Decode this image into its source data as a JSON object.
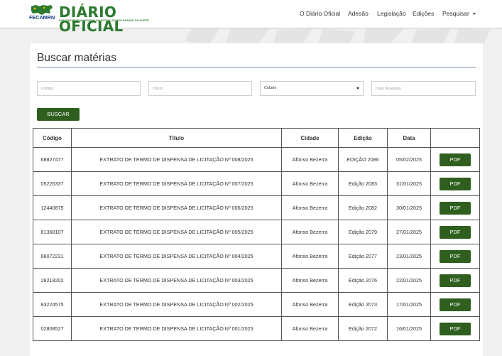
{
  "header": {
    "logo_abbr": "FECAMRN",
    "logo_title": "DIÁRIO OFICIAL",
    "logo_subtitle": "DAS CÂMARAS MUNICIPAIS DO ESTADO DO RIO GRANDE DO NORTE",
    "nav": [
      {
        "label": "O Diário Oficial"
      },
      {
        "label": "Adesão"
      },
      {
        "label": "Legislação"
      },
      {
        "label": "Edições"
      },
      {
        "label": "Pesquisar"
      }
    ]
  },
  "search": {
    "title": "Buscar matérias",
    "codigo_placeholder": "Código",
    "titulo_placeholder": "Título",
    "cidade_selected": "Cidade",
    "data_placeholder": "Data desejada",
    "button_label": "BUSCAR"
  },
  "table": {
    "headers": [
      "Código",
      "Título",
      "Cidade",
      "Edição",
      "Data",
      ""
    ],
    "rows": [
      {
        "codigo": "68827477",
        "titulo": "EXTRATO DE TERMO DE DISPENSA DE LICITAÇÃO Nº 008/2025",
        "cidade": "Afonso Bezerra",
        "edicao": "EDIÇÃO 2086",
        "data": "05/02/2025",
        "action": "PDF"
      },
      {
        "codigo": "05226337",
        "titulo": "EXTRATO DE TERMO DE DISPENSA DE LICITAÇÃO Nº 007/2025",
        "cidade": "Afonso Bezerra",
        "edicao": "Edição 2083",
        "data": "31/01/2025",
        "action": "PDF"
      },
      {
        "codigo": "12440875",
        "titulo": "EXTRATO DE TERMO DE DISPENSA DE LICITAÇÃO Nº 006/2025",
        "cidade": "Afonso Bezerra",
        "edicao": "Edição 2082",
        "data": "30/01/2025",
        "action": "PDF"
      },
      {
        "codigo": "81368107",
        "titulo": "EXTRATO DE TERMO DE DISPENSA DE LICITAÇÃO Nº 005/2025",
        "cidade": "Afonso Bezerra",
        "edicao": "Edição 2079",
        "data": "27/01/2025",
        "action": "PDF"
      },
      {
        "codigo": "66072231",
        "titulo": "EXTRATO DE TERMO DE DISPENSA DE LICITAÇÃO Nº 004/2025",
        "cidade": "Afonso Bezerra",
        "edicao": "Edição 2077",
        "data": "23/01/2025",
        "action": "PDF"
      },
      {
        "codigo": "28218202",
        "titulo": "EXTRATO DE TERMO DE DISPENSA DE LICITAÇÃO Nº 003/2025",
        "cidade": "Afonso Bezerra",
        "edicao": "Edição 2076",
        "data": "22/01/2025",
        "action": "PDF"
      },
      {
        "codigo": "83224575",
        "titulo": "EXTRATO DE TERMO DE DISPENSA DE LICITAÇÃO Nº 002/2025",
        "cidade": "Afonso Bezerra",
        "edicao": "Edição 2073",
        "data": "17/01/2025",
        "action": "PDF"
      },
      {
        "codigo": "02808527",
        "titulo": "EXTRATO DE TERMO DE DISPENSA DE LICITAÇÃO Nº 001/2025",
        "cidade": "Afonso Bezerra",
        "edicao": "Edição 2072",
        "data": "16/01/2025",
        "action": "PDF"
      }
    ]
  },
  "colors": {
    "brand_green": "#2b7a2e",
    "button_green": "#2e5f1e",
    "logo_blue": "#1c3f8a"
  },
  "icons": {
    "dropdown": "chevron-down-icon",
    "logo": "rn-state-map-icon"
  }
}
